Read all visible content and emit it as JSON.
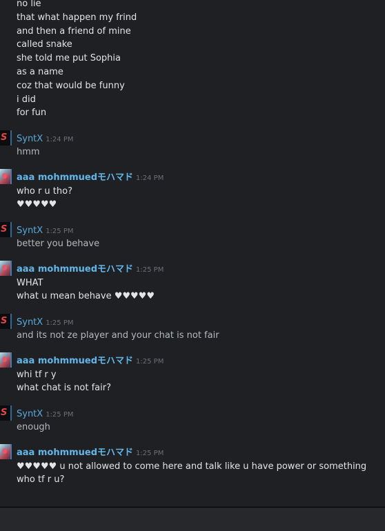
{
  "chat": {
    "top_lines": [
      "no lie",
      "that what happen my frind",
      "and then a friend of mine",
      "called snake",
      "she told me put Sophia",
      "as a name",
      "coz that would be funny",
      "i did",
      "for fun"
    ],
    "messages": [
      {
        "author": "SyntX",
        "time": "1:24 PM",
        "avatar": "syntx-logo",
        "lines": [
          "hmm"
        ]
      },
      {
        "author": "aaa mohmmuedモハマド",
        "time": "1:24 PM",
        "avatar": "anime-avatar",
        "lines": [
          "who r u tho?",
          "♥♥♥♥♥"
        ]
      },
      {
        "author": "SyntX",
        "time": "1:25 PM",
        "avatar": "syntx-logo",
        "lines": [
          "better you behave"
        ]
      },
      {
        "author": "aaa mohmmuedモハマド",
        "time": "1:25 PM",
        "avatar": "anime-avatar",
        "lines": [
          "WHAT",
          "what u mean behave ♥♥♥♥♥"
        ]
      },
      {
        "author": "SyntX",
        "time": "1:25 PM",
        "avatar": "syntx-logo",
        "lines": [
          "and its not ze player and your chat is not fair"
        ]
      },
      {
        "author": "aaa mohmmuedモハマド",
        "time": "1:25 PM",
        "avatar": "anime-avatar",
        "lines": [
          "whi tf r y",
          "what chat is not fair?"
        ]
      },
      {
        "author": "SyntX",
        "time": "1:25 PM",
        "avatar": "syntx-logo",
        "lines": [
          "enough"
        ]
      },
      {
        "author": "aaa mohmmuedモハマド",
        "time": "1:25 PM",
        "avatar": "anime-avatar",
        "lines": [
          "♥♥♥♥♥ u not allowed to come here and talk like u have power or something",
          "who tf r u?"
        ]
      }
    ]
  },
  "composer": {
    "value": ""
  },
  "colors": {
    "background": "#1e2023",
    "text_primary": "#e2e4e8",
    "text_secondary": "#b5b8bd",
    "name_link": "#5aaadc",
    "timestamp": "#6d7075",
    "syntx_logo": "#e04848"
  }
}
